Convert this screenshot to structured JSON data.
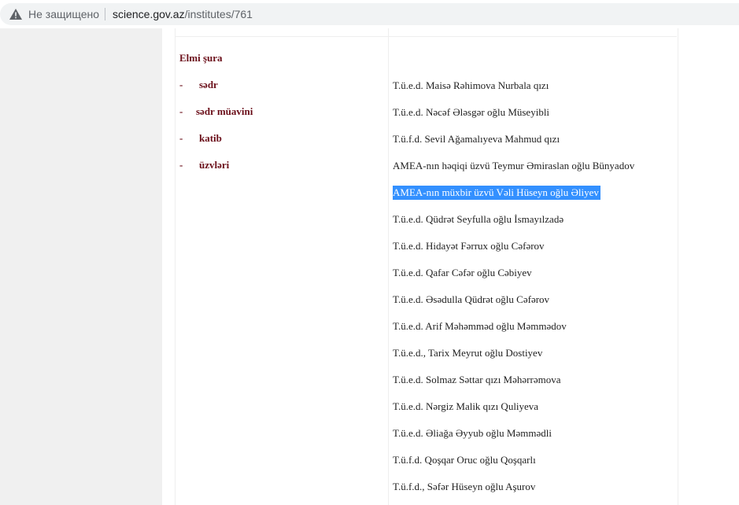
{
  "browser": {
    "security_label": "Не защищено",
    "url_host": "science.gov.az",
    "url_path": "/institutes/761"
  },
  "council": {
    "title": "Elmi şura",
    "roles": [
      {
        "dash": "-",
        "label": "sədr"
      },
      {
        "dash": "-",
        "label": "sədr müavini"
      },
      {
        "dash": "-",
        "label": "katib"
      },
      {
        "dash": "-",
        "label": "üzvləri"
      }
    ],
    "members": [
      "T.ü.e.d. Maisə Rəhimova Nurbala qızı",
      "T.ü.e.d. Nəcəf Ələsgər oğlu Müseyibli",
      "T.ü.f.d. Sevil Ağamalıyeva Mahmud qızı",
      "AMEA-nın həqiqi üzvü Teymur Əmiraslan oğlu Bünyadov",
      "AMEA-nın müxbir üzvü Vəli Hüseyn oğlu Əliyev",
      "T.ü.e.d. Qüdrət Seyfulla oğlu İsmayılzadə",
      "T.ü.e.d. Hidayət Fərrux oğlu Cəfərov",
      "T.ü.e.d. Qafar Cəfər oğlu Cəbiyev",
      "T.ü.e.d. Əsədulla Qüdrət oğlu Cəfərov",
      "T.ü.e.d. Arif Məhəmməd oğlu Məmmədov",
      "T.ü.e.d., Tarix Meyrut oğlu Dostiyev",
      "T.ü.e.d. Solmaz Səttar qızı Məhərrəmova",
      "T.ü.e.d. Nərgiz Malik qızı Quliyeva",
      "T.ü.e.d. Əliağa Əyyub oğlu Məmmədli",
      "T.ü.f.d. Qoşqar Oruc oğlu Qoşqarlı",
      "T.ü.f.d., Səfər Hüseyn oğlu Aşurov"
    ]
  },
  "colors": {
    "accent": "#6b0f1a",
    "selection": "#3390ff",
    "gutter": "#f0f0f0"
  },
  "icons": {
    "security": "warning-triangle-icon"
  }
}
